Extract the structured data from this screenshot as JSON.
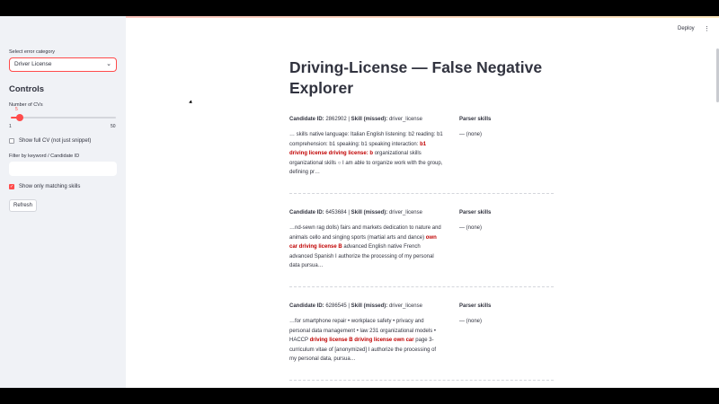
{
  "sidebar": {
    "category_label": "Select error category",
    "category_value": "Driver License",
    "controls_heading": "Controls",
    "num_cvs_label": "Number of CVs",
    "num_cvs_value": "5",
    "num_cvs_min": "1",
    "num_cvs_max": "50",
    "num_cvs_fraction": 0.082,
    "show_full_cv_label": "Show full CV (not just snippet)",
    "show_full_cv_checked": false,
    "filter_label": "Filter by keyword / Candidate ID",
    "filter_value": "",
    "only_matching_label": "Show only matching skills",
    "only_matching_checked": true,
    "refresh_label": "Refresh"
  },
  "header": {
    "deploy_label": "Deploy",
    "menu_glyph": "⋮"
  },
  "main": {
    "title": "Driving-License — False Negative Explorer",
    "cards": [
      {
        "id_label": "Candidate ID:",
        "id_value": "2862902",
        "skill_label": "Skill (missed):",
        "skill_value": "driver_license",
        "parser_label": "Parser skills",
        "parser_value": "— (none)",
        "snippet_before": "… skills native language: Italian English listening: b2 reading: b1 comprehension: b1 speaking: b1 speaking interaction: ",
        "snippet_hl": "b1 driving license driving license: b",
        "snippet_after": " organizational skills organizational skills ○ I am able to organize work with the group, defining pr…"
      },
      {
        "id_label": "Candidate ID:",
        "id_value": "6453684",
        "skill_label": "Skill (missed):",
        "skill_value": "driver_license",
        "parser_label": "Parser skills",
        "parser_value": "— (none)",
        "snippet_before": "…nd-sewn rag dolls) fairs and markets dedication to nature and animals cello and singing sports (martial arts and dance) ",
        "snippet_hl": "own car driving license B",
        "snippet_after": " advanced English native French advanced Spanish I authorize the processing of my personal data pursua…"
      },
      {
        "id_label": "Candidate ID:",
        "id_value": "6286545",
        "skill_label": "Skill (missed):",
        "skill_value": "driver_license",
        "parser_label": "Parser skills",
        "parser_value": "— (none)",
        "snippet_before": "…for smartphone repair • workplace safety • privacy and personal data management • law 231 organizational models • HACCP ",
        "snippet_hl": "driving license B driving license own car",
        "snippet_after": " page 3- curriculum vitae of [anonymized] I authorize the processing of my personal data, pursua…"
      }
    ]
  },
  "colors": {
    "accent": "#ff4b4b",
    "highlight": "#c00000",
    "sidebar_bg": "#f0f2f6"
  },
  "icons": {
    "select_chevron": "chevron-down-icon",
    "checkbox_check": "check-icon"
  }
}
